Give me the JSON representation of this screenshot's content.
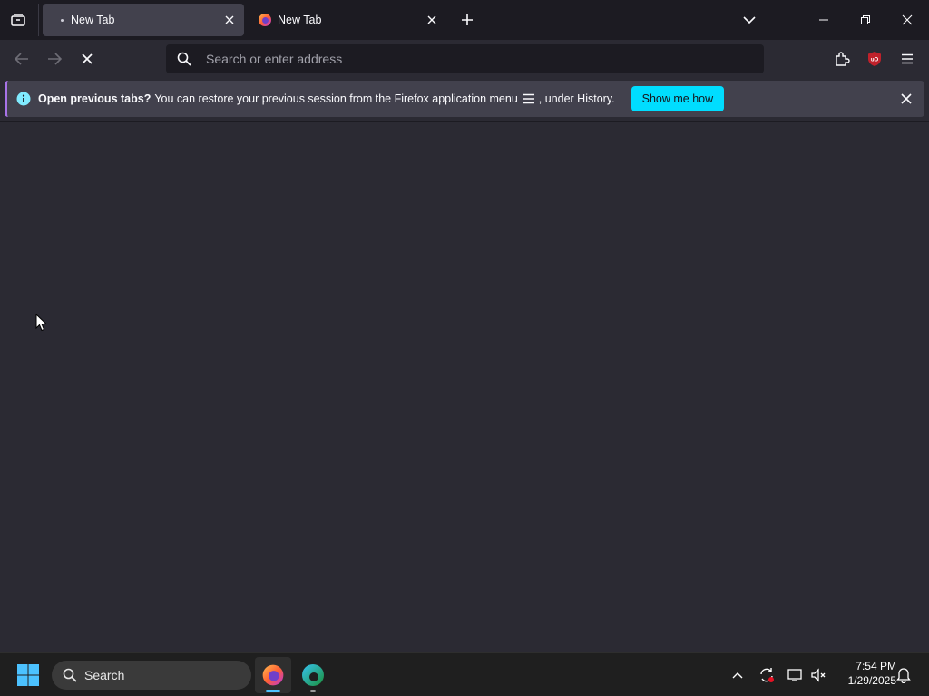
{
  "tabs": [
    {
      "title": "New Tab",
      "active": true
    },
    {
      "title": "New Tab",
      "active": false
    }
  ],
  "urlbar": {
    "placeholder": "Search or enter address",
    "value": ""
  },
  "notification": {
    "bold": "Open previous tabs?",
    "text_before_icon": "You can restore your previous session from the Firefox application menu",
    "text_after_icon": ", under History.",
    "button": "Show me how"
  },
  "taskbar": {
    "search_label": "Search",
    "time": "7:54 PM",
    "date": "1/29/2025"
  },
  "colors": {
    "accent_button": "#00ddff",
    "notification_stripe": "#a873e8",
    "ublock_red": "#c0212b"
  },
  "icons": [
    "tab-list-icon",
    "close-icon",
    "plus-icon",
    "chevron-down-icon",
    "minimize-icon",
    "restore-icon",
    "back-arrow-icon",
    "forward-arrow-icon",
    "stop-icon",
    "search-icon",
    "extensions-icon",
    "ublock-icon",
    "hamburger-menu-icon",
    "info-icon",
    "windows-start-icon",
    "firefox-icon",
    "edge-icon",
    "chevron-up-icon",
    "sync-icon",
    "display-icon",
    "volume-muted-icon",
    "notification-bell-icon"
  ]
}
